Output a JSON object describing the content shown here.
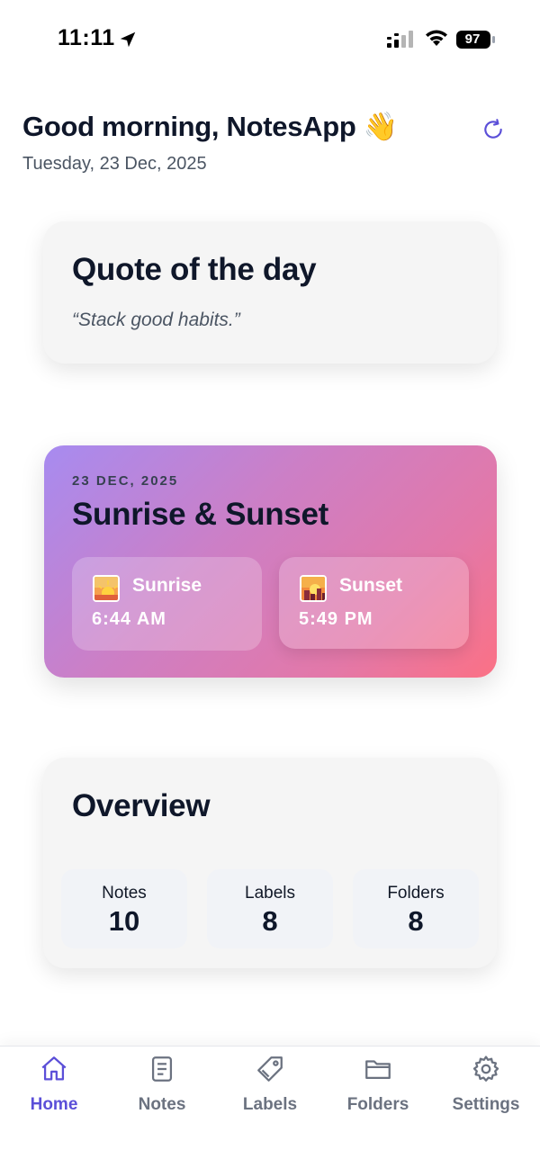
{
  "status_bar": {
    "time": "11:11",
    "battery": "97"
  },
  "header": {
    "greeting": "Good morning, NotesApp 👋",
    "date": "Tuesday, 23 Dec, 2025"
  },
  "quote": {
    "title": "Quote of the day",
    "text": "“Stack good habits.”"
  },
  "sun": {
    "date": "23 DEC, 2025",
    "title": "Sunrise & Sunset",
    "sunrise": {
      "label": "Sunrise",
      "time": "6:44 AM"
    },
    "sunset": {
      "label": "Sunset",
      "time": "5:49 PM"
    }
  },
  "overview": {
    "title": "Overview",
    "stats": [
      {
        "label": "Notes",
        "value": "10"
      },
      {
        "label": "Labels",
        "value": "8"
      },
      {
        "label": "Folders",
        "value": "8"
      }
    ]
  },
  "tabs": [
    {
      "label": "Home",
      "icon": "home-icon",
      "active": true
    },
    {
      "label": "Notes",
      "icon": "notes-icon",
      "active": false
    },
    {
      "label": "Labels",
      "icon": "tag-icon",
      "active": false
    },
    {
      "label": "Folders",
      "icon": "folder-icon",
      "active": false
    },
    {
      "label": "Settings",
      "icon": "gear-icon",
      "active": false
    }
  ],
  "colors": {
    "accent": "#5b4fd8",
    "card_bg": "#f5f5f5",
    "gradient_start": "#a78bf0",
    "gradient_end": "#fb7185"
  }
}
